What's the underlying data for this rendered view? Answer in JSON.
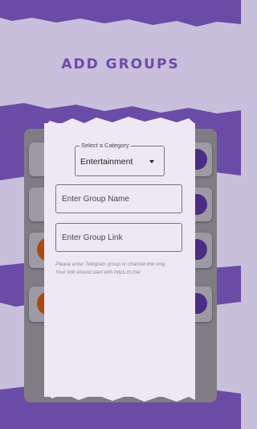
{
  "page": {
    "title": "ADD GROUPS"
  },
  "dialog": {
    "category": {
      "label": "Select a Category",
      "value": "Entertainment",
      "icon": "caret-down-icon"
    },
    "group_name": {
      "placeholder": "Enter Group Name",
      "value": ""
    },
    "group_link": {
      "placeholder": "Enter Group Link",
      "value": ""
    },
    "hint_line1": "Please enter Telegram group or channel link only.",
    "hint_line2": "Your link should start with https://t.me/"
  },
  "colors": {
    "accent": "#6b4bab",
    "background_light": "#c7bfdb",
    "dialog_bg": "#eee8f4",
    "overlay": "#7f7d83"
  }
}
